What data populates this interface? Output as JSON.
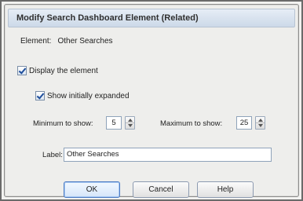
{
  "dialog": {
    "title": "Modify Search Dashboard Element (Related)",
    "element_label": "Element:",
    "element_value": "Other Searches"
  },
  "options": {
    "display_element": {
      "label": "Display the element",
      "checked": true
    },
    "show_expanded": {
      "label": "Show initially expanded",
      "checked": true
    }
  },
  "limits": {
    "minimum_label": "Minimum to show:",
    "minimum_value": "5",
    "maximum_label": "Maximum to show:",
    "maximum_value": "25"
  },
  "label_field": {
    "label": "Label:",
    "value": "Other Searches"
  },
  "buttons": {
    "ok": "OK",
    "cancel": "Cancel",
    "help": "Help"
  }
}
